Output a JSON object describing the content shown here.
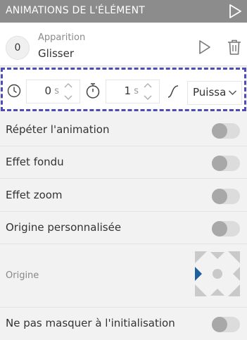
{
  "panel": {
    "title": "ANIMATIONS DE L'ÉLÉMENT",
    "play_icon": "play-outline-icon"
  },
  "animation": {
    "order": "0",
    "category": "Apparition",
    "name": "Glisser",
    "play_icon": "play-outline-icon",
    "delete_icon": "trash-icon"
  },
  "timing": {
    "delay": {
      "icon": "clock-icon",
      "value": "0",
      "unit": "s"
    },
    "duration": {
      "icon": "stopwatch-icon",
      "value": "1",
      "unit": "s"
    },
    "easing": {
      "icon": "easing-curve-icon",
      "value": "Puissance"
    }
  },
  "options": [
    {
      "label": "Répéter l'animation",
      "on": false
    },
    {
      "label": "Effet fondu",
      "on": false
    },
    {
      "label": "Effet zoom",
      "on": false
    },
    {
      "label": "Origine personnalisée",
      "on": false
    }
  ],
  "origin": {
    "label": "Origine",
    "selected": "left"
  },
  "last_option": {
    "label": "Ne pas masquer à l'initialisation",
    "on": false
  },
  "colors": {
    "header_bg": "#8c8c8c",
    "selection_border": "#4c4cb3",
    "origin_selected": "#1f5f9e",
    "origin_unselected": "#c9c9c9"
  }
}
